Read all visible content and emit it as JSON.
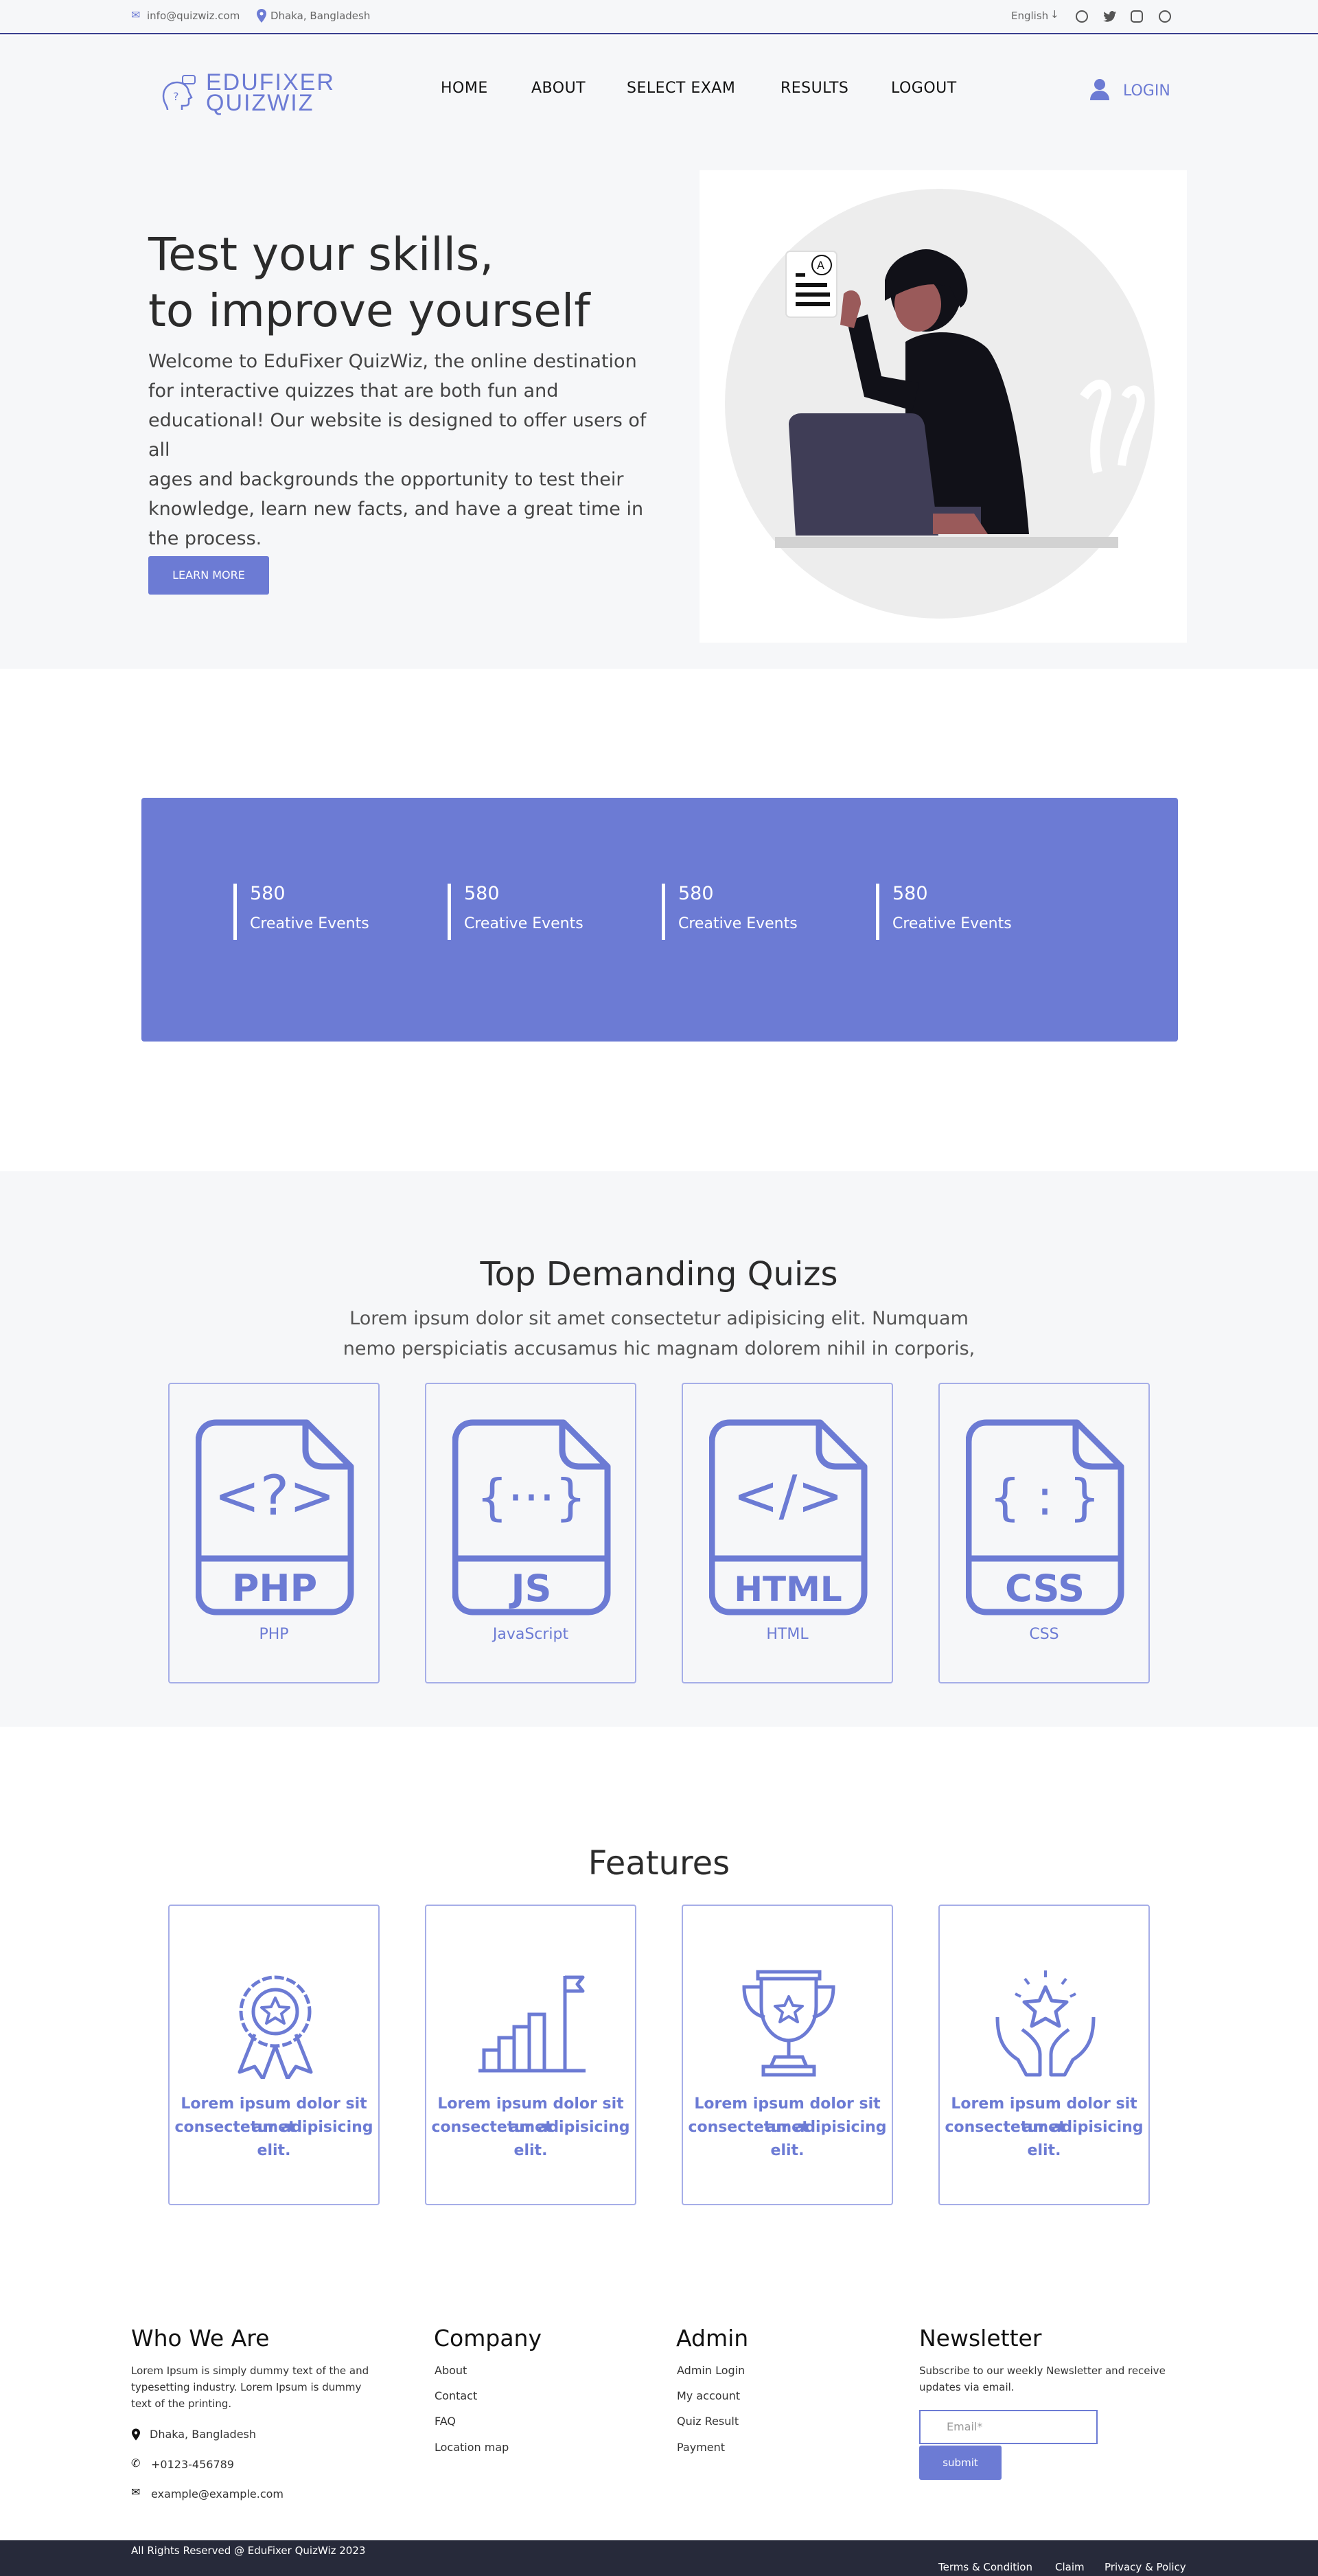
{
  "topbar": {
    "email": "info@quizwiz.com",
    "location": "Dhaka, Bangladesh",
    "language": "English"
  },
  "header": {
    "logo_line1": "EDUFIXER",
    "logo_line2": "QUIZWIZ",
    "nav": [
      "HOME",
      "ABOUT",
      "SELECT EXAM",
      "RESULTS",
      "LOGOUT"
    ],
    "login": "LOGIN"
  },
  "hero": {
    "title_line1": "Test your skills,",
    "title_line2": "to improve yourself",
    "desc_lines": [
      "Welcome to EduFixer QuizWiz, the online destination",
      "for interactive quizzes that are both fun and",
      "educational! Our website is designed to offer users of all",
      "ages and backgrounds the opportunity to test their",
      "knowledge, learn new facts, and have a great time in",
      "the process."
    ],
    "button": "LEARN MORE"
  },
  "stats": [
    {
      "num": "580",
      "label": "Creative Events"
    },
    {
      "num": "580",
      "label": "Creative Events"
    },
    {
      "num": "580",
      "label": "Creative Events"
    },
    {
      "num": "580",
      "label": "Creative Events"
    }
  ],
  "quizzes": {
    "title": "Top Demanding Quizs",
    "sub_line1": "Lorem ipsum dolor sit amet consectetur adipisicing elit. Numquam",
    "sub_line2": "nemo perspiciatis accusamus hic magnam dolorem nihil in corporis,",
    "items": [
      {
        "label": "PHP",
        "file_label": "PHP",
        "glyph": "<?>"
      },
      {
        "label": "JavaScript",
        "file_label": "JS",
        "glyph": "{···}"
      },
      {
        "label": "HTML",
        "file_label": "HTML",
        "glyph": "</>"
      },
      {
        "label": "CSS",
        "file_label": "CSS",
        "glyph": "{ : }"
      }
    ]
  },
  "features": {
    "title": "Features",
    "items": [
      {
        "icon": "award-ribbon-icon",
        "line1": "Lorem ipsum dolor sit amet",
        "line2": "consectetur adipisicing elit."
      },
      {
        "icon": "growth-chart-flag-icon",
        "line1": "Lorem ipsum dolor sit amet",
        "line2": "consectetur adipisicing elit."
      },
      {
        "icon": "trophy-icon",
        "line1": "Lorem ipsum dolor sit amet",
        "line2": "consectetur adipisicing elit."
      },
      {
        "icon": "hands-star-icon",
        "line1": "Lorem ipsum dolor sit amet",
        "line2": "consectetur adipisicing elit."
      }
    ]
  },
  "footer": {
    "who": {
      "title": "Who We Are",
      "text_lines": [
        "Lorem Ipsum is simply dummy text of the and",
        "typesetting industry. Lorem Ipsum is dummy",
        "text of the printing."
      ],
      "address": "Dhaka, Bangladesh",
      "phone": "+0123-456789",
      "email": "example@example.com"
    },
    "company": {
      "title": "Company",
      "links": [
        "About",
        "Contact",
        "FAQ",
        "Location map"
      ]
    },
    "admin": {
      "title": "Admin",
      "links": [
        "Admin Login",
        "My account",
        "Quiz Result",
        "Payment"
      ]
    },
    "newsletter": {
      "title": "Newsletter",
      "text_lines": [
        "Subscribe to our weekly Newsletter and receive",
        "updates via email."
      ],
      "placeholder": "Email*",
      "button": "submit"
    },
    "copyright": "All Rights Reserved @ EduFixer QuizWiz 2023",
    "bottom_links": [
      "Terms & Condition",
      "Claim",
      "Privacy & Policy"
    ]
  },
  "colors": {
    "accent": "#6c7bd4",
    "footer_bg": "#272a3a",
    "section_bg": "#f6f7f9"
  }
}
